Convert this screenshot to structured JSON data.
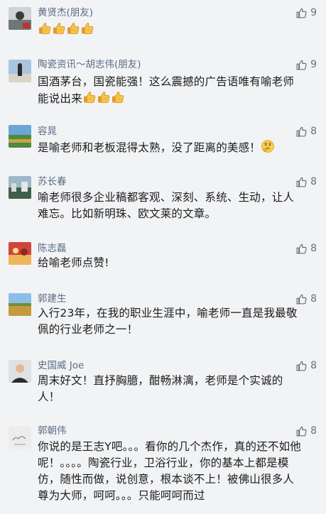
{
  "comments": [
    {
      "name": "黄贤杰(朋友)",
      "likes": "9",
      "text": "",
      "emoji": "thumbs-up-icon"
    },
    {
      "name": "陶瓷资讯～胡志伟(朋友)",
      "likes": "9",
      "text": "国酒茅台，国瓷能强！这么震撼的广告语唯有喻老师能说出来",
      "emoji": "thumbs-up-icon"
    },
    {
      "name": "容晁",
      "likes": "8",
      "text": "是喻老师和老板混得太熟，没了距离的美感！",
      "emoji": "thinking-face-icon"
    },
    {
      "name": "苏长春",
      "likes": "8",
      "text": "喻老师很多企业稿都客观、深刻、系统、生动，让人难忘。比如新明珠、欧文莱的文章。"
    },
    {
      "name": "陈志磊",
      "likes": "8",
      "text": "给喻老师点赞!"
    },
    {
      "name": "郭建生",
      "likes": "8",
      "text": "入行23年，在我的职业生涯中，喻老师一直是我最敬佩的行业老师之一！"
    },
    {
      "name": "史国威 Joe",
      "likes": "8",
      "text": "周末好文！直抒胸臆，酣畅淋漓，老师是个实诚的人！"
    },
    {
      "name": "郭朝伟",
      "likes": "8",
      "text": "你说的是王志Y吧。。。看你的几个杰作，真的还不如他呢！。。。。陶瓷行业，卫浴行业，你的基本上都是模仿，随性而做，说创意，根本谈不上！被佛山很多人尊为大师，呵呵。。。只能呵呵而过"
    }
  ],
  "colors": {
    "name": "#5b6b86",
    "text": "#1b1b1b",
    "background": "#f2f3f5",
    "like": "#6a6f78"
  }
}
